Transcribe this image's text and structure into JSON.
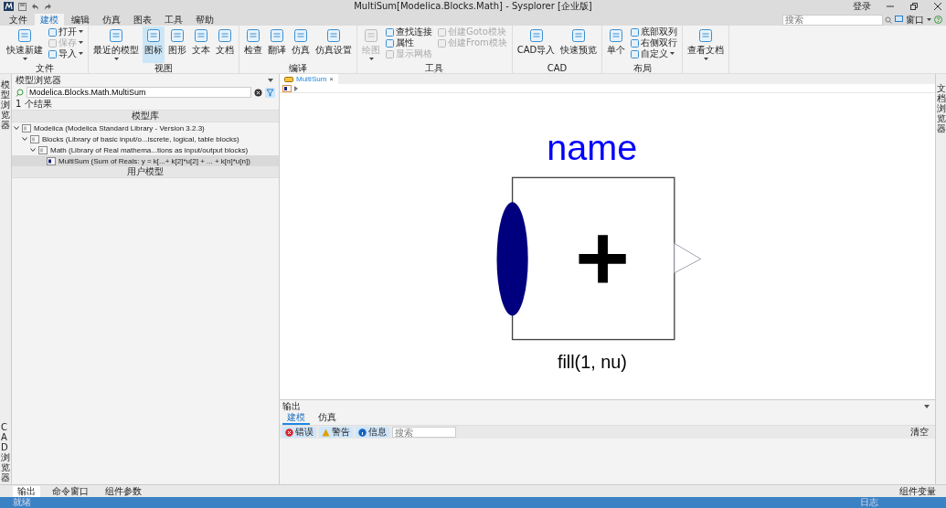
{
  "title_bar": {
    "title": "MultiSum[Modelica.Blocks.Math] - Sysplorer [企业版]",
    "login": "登录"
  },
  "menu": [
    {
      "label": "文件",
      "selected": false
    },
    {
      "label": "建模",
      "selected": true
    },
    {
      "label": "编辑",
      "selected": false
    },
    {
      "label": "仿真",
      "selected": false
    },
    {
      "label": "图表",
      "selected": false
    },
    {
      "label": "工具",
      "selected": false
    },
    {
      "label": "帮助",
      "selected": false
    }
  ],
  "search": {
    "placeholder": "搜索"
  },
  "window_menu": "窗口",
  "ribbon": [
    {
      "label": "文件",
      "items": [
        {
          "kind": "large",
          "label": "快速新建",
          "dropdown": true,
          "selected": false,
          "disabled": false
        },
        {
          "kind": "stack",
          "items": [
            {
              "label": "打开",
              "dropdown": true,
              "disabled": false
            },
            {
              "label": "保存",
              "dropdown": true,
              "disabled": true
            },
            {
              "label": "导入",
              "dropdown": true,
              "disabled": false
            }
          ]
        }
      ]
    },
    {
      "label": "视图",
      "items": [
        {
          "kind": "large",
          "label": "最近的模型",
          "dropdown": true,
          "selected": false,
          "disabled": false
        },
        {
          "kind": "large",
          "label": "图标",
          "dropdown": false,
          "selected": true,
          "disabled": false
        },
        {
          "kind": "large",
          "label": "图形",
          "dropdown": false,
          "selected": false,
          "disabled": false
        },
        {
          "kind": "large",
          "label": "文本",
          "dropdown": false,
          "selected": false,
          "disabled": false
        },
        {
          "kind": "large",
          "label": "文档",
          "dropdown": false,
          "selected": false,
          "disabled": false
        }
      ]
    },
    {
      "label": "编译",
      "items": [
        {
          "kind": "large",
          "label": "检查",
          "dropdown": false,
          "selected": false,
          "disabled": false
        },
        {
          "kind": "large",
          "label": "翻译",
          "dropdown": false,
          "selected": false,
          "disabled": false
        },
        {
          "kind": "large",
          "label": "仿真",
          "dropdown": false,
          "selected": false,
          "disabled": false
        },
        {
          "kind": "large",
          "label": "仿真设置",
          "dropdown": false,
          "selected": false,
          "disabled": false
        }
      ]
    },
    {
      "label": "工具",
      "items": [
        {
          "kind": "large",
          "label": "绘图",
          "dropdown": true,
          "selected": false,
          "disabled": true
        },
        {
          "kind": "stack",
          "items": [
            {
              "label": "查找连接",
              "dropdown": false,
              "disabled": false
            },
            {
              "label": "属性",
              "dropdown": false,
              "disabled": false
            },
            {
              "label": "显示网格",
              "dropdown": false,
              "disabled": true
            }
          ]
        },
        {
          "kind": "stack",
          "items": [
            {
              "label": "创建Goto模块",
              "dropdown": false,
              "disabled": true
            },
            {
              "label": "创建From模块",
              "dropdown": false,
              "disabled": true
            }
          ]
        }
      ]
    },
    {
      "label": "CAD",
      "items": [
        {
          "kind": "large",
          "label": "CAD导入",
          "dropdown": false,
          "selected": false,
          "disabled": false
        },
        {
          "kind": "large",
          "label": "快速预览",
          "dropdown": false,
          "selected": false,
          "disabled": false
        }
      ]
    },
    {
      "label": "布局",
      "items": [
        {
          "kind": "large",
          "label": "单个",
          "dropdown": false,
          "selected": false,
          "disabled": false
        },
        {
          "kind": "stack",
          "items": [
            {
              "label": "底部双列",
              "dropdown": false,
              "disabled": false
            },
            {
              "label": "右侧双行",
              "dropdown": false,
              "disabled": false
            },
            {
              "label": "自定义",
              "dropdown": true,
              "disabled": false
            }
          ]
        }
      ]
    },
    {
      "items": [
        {
          "kind": "large",
          "label": "查看文档",
          "dropdown": true,
          "selected": false,
          "disabled": false
        }
      ]
    }
  ],
  "left_strip": {
    "top": "模型浏览器",
    "bottom": "CAD浏览器"
  },
  "right_strip": "文档浏览器",
  "model_browser": {
    "title": "模型浏览器",
    "search_value": "Modelica.Blocks.Math.MultiSum",
    "results": "1 个结果",
    "library_section": "模型库",
    "tree": [
      {
        "label": "Modelica (Modelica Standard Library - Version 3.2.3)",
        "expanded": true,
        "selected": false,
        "children": [
          {
            "label": "Blocks (Library of basic input/o...iscrete, logical, table blocks)",
            "expanded": true,
            "selected": false,
            "children": [
              {
                "label": "Math (Library of Real mathema...tions as input/output blocks)",
                "expanded": true,
                "selected": false,
                "children": [
                  {
                    "label": "MultiSum (Sum of Reals: y = k[...+ k[2]*u[2] + ... + k[n]*u[n])",
                    "selected": true
                  }
                ]
              }
            ]
          }
        ]
      }
    ],
    "user_section": "用户模型"
  },
  "editor": {
    "tab": "MultiSum",
    "close": "×",
    "diagram": {
      "name": "name",
      "label": "fill(1, nu)"
    }
  },
  "output": {
    "title": "输出",
    "tabs": [
      {
        "label": "建模",
        "selected": true
      },
      {
        "label": "仿真",
        "selected": false
      }
    ],
    "filters": [
      {
        "label": "错误",
        "kind": "error"
      },
      {
        "label": "警告",
        "kind": "warning"
      },
      {
        "label": "信息",
        "kind": "info"
      }
    ],
    "search_placeholder": "搜索",
    "clear": "清空"
  },
  "bottom_tabs": [
    {
      "label": "输出",
      "selected": true
    },
    {
      "label": "命令窗口",
      "selected": false
    },
    {
      "label": "组件参数",
      "selected": false
    }
  ],
  "bottom_right": "组件变量",
  "status_bar": {
    "left": "就绪",
    "right": "日志"
  }
}
